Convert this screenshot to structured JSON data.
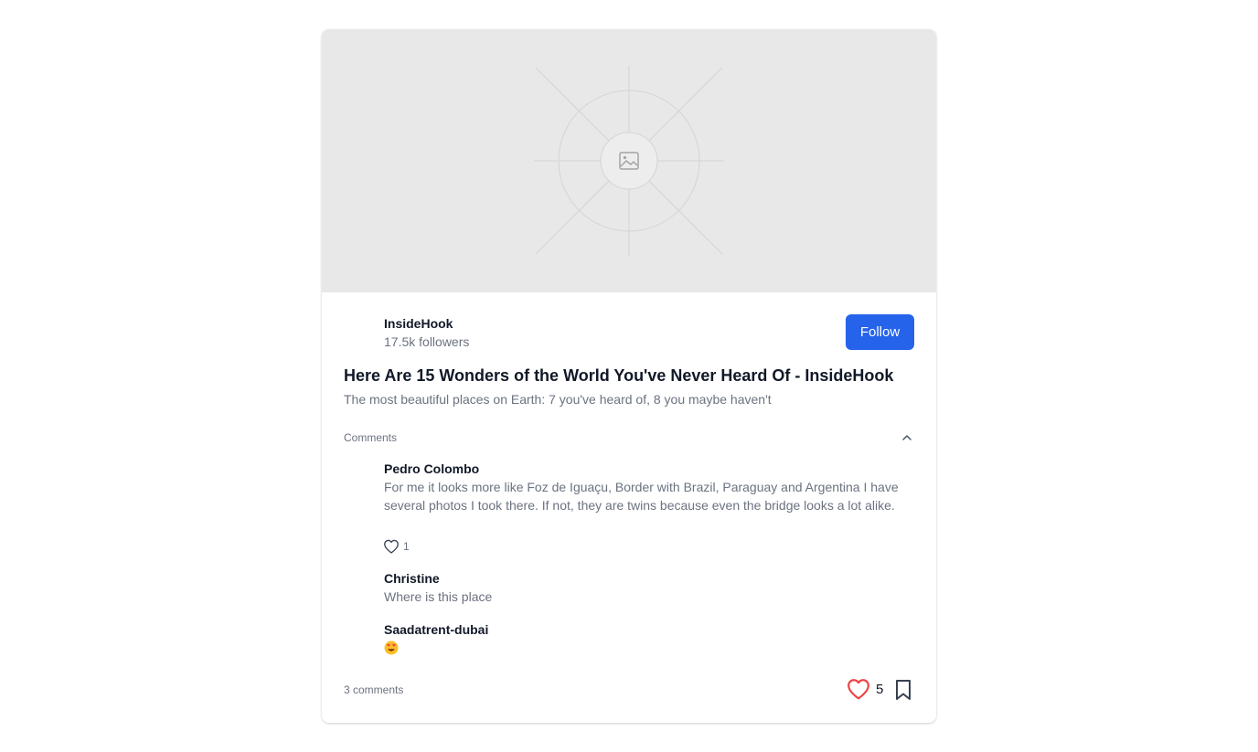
{
  "post": {
    "author": {
      "name": "InsideHook",
      "followers": "17.5k followers"
    },
    "follow_label": "Follow",
    "title": "Here Are 15 Wonders of the World You've Never Heard Of - InsideHook",
    "subtitle": "The most beautiful places on Earth: 7 you've heard of, 8 you maybe haven't",
    "image_placeholder_icon": "image-icon"
  },
  "comments": {
    "header": "Comments",
    "items": [
      {
        "author": "Pedro Colombo",
        "text": "For me it looks more like Foz de Iguaçu, Border with Brazil, Paraguay and Argentina I have several photos I took there. If not, they are twins because even the bridge looks a lot alike.",
        "likes": "1"
      },
      {
        "author": "Christine",
        "text": "Where is this place"
      },
      {
        "author": "Saadatrent-dubai",
        "emoji": "heart-eyes-emoji"
      }
    ]
  },
  "footer": {
    "comment_count": "3 comments",
    "likes": "5"
  },
  "colors": {
    "accent": "#2563eb",
    "heart": "#ef4444",
    "muted_text": "#6b7280",
    "placeholder_bg": "#e8e8e8"
  }
}
